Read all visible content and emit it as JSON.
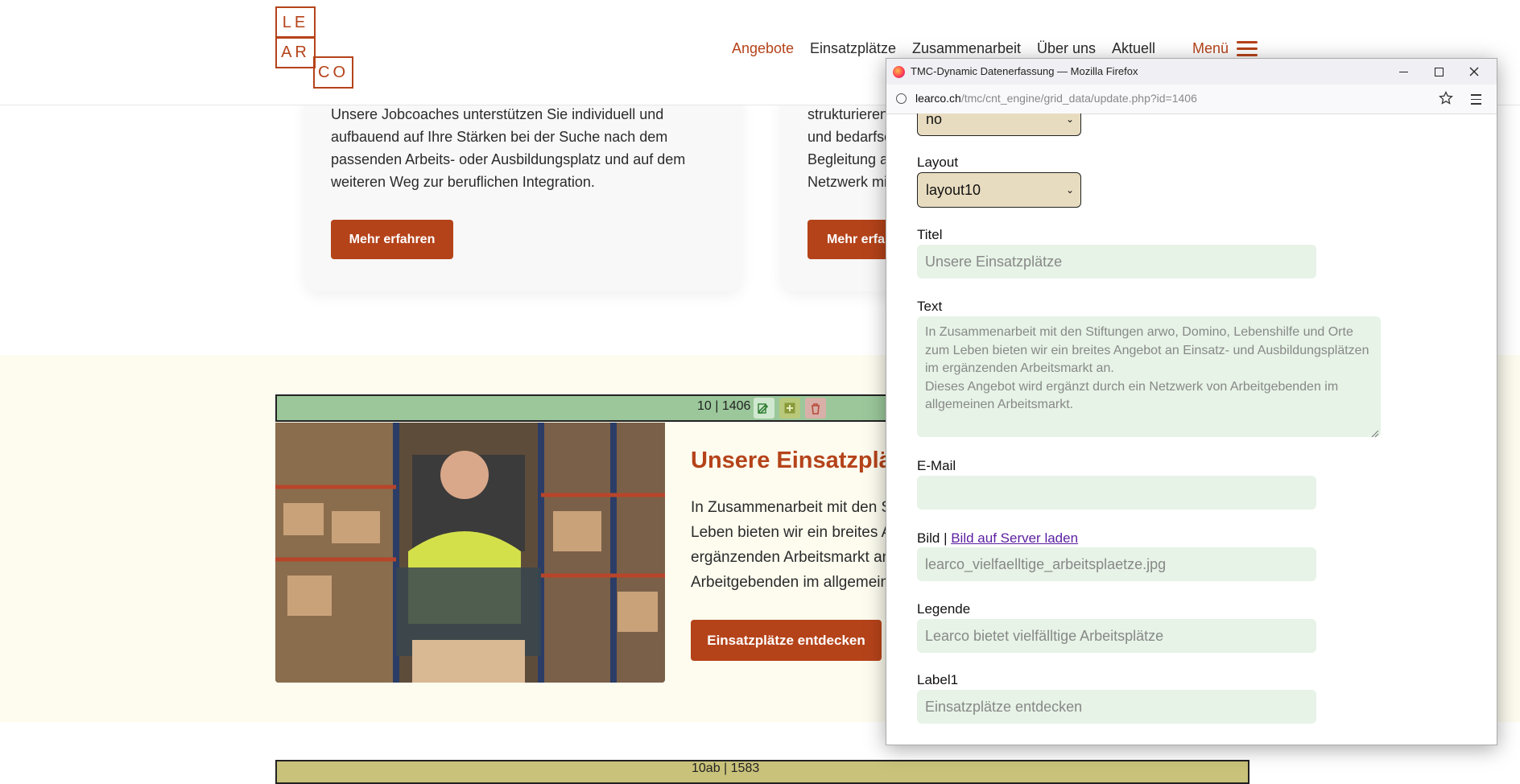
{
  "header": {
    "logo_letters": [
      "LE",
      "AR",
      "CO"
    ],
    "nav": [
      {
        "label": "Angebote",
        "active": true
      },
      {
        "label": "Einsatzplätze",
        "active": false
      },
      {
        "label": "Zusammenarbeit",
        "active": false
      },
      {
        "label": "Über uns",
        "active": false
      },
      {
        "label": "Aktuell",
        "active": false
      }
    ],
    "menu_label": "Menü"
  },
  "cards": [
    {
      "text_lines": [
        "Unsere Jobcoaches unterstützen Sie individuell und",
        "aufbauend auf Ihre Stärken bei der Suche nach dem",
        "passenden Arbeits- oder Ausbildungsplatz und auf dem",
        "weiteren Weg zur beruflichen Integration."
      ],
      "button": "Mehr erfahren"
    },
    {
      "text_lines": [
        "strukturieren",
        "und bedarfso",
        "Begleitung a",
        "Netzwerk mi"
      ],
      "button": "Mehr erfa"
    }
  ],
  "section": {
    "admin_id": "10 | 1406",
    "title": "Unsere Einsatzplät",
    "text_lines": [
      "In Zusammenarbeit mit den S",
      "Leben bieten wir ein breites A",
      "ergänzenden Arbeitsmarkt an",
      "Arbeitgebenden im allgemein"
    ],
    "button": "Einsatzplätze entdecken",
    "admin_id_2": "10ab | 1583"
  },
  "firefox": {
    "window_title": "TMC-Dynamic Datenerfassung — Mozilla Firefox",
    "url_domain": "learco.ch",
    "url_path": "/tmc/cnt_engine/grid_data/update.php?id=1406",
    "form": {
      "top_select_value": "no",
      "layout_label": "Layout",
      "layout_value": "layout10",
      "titel_label": "Titel",
      "titel_value": "Unsere Einsatzplätze",
      "text_label": "Text",
      "text_value": "In Zusammenarbeit mit den Stiftungen arwo, Domino, Lebenshilfe und Orte zum Leben bieten wir ein breites Angebot an Einsatz- und Ausbildungsplätzen im ergänzenden Arbeitsmarkt an.\nDieses Angebot wird ergänzt durch ein Netzwerk von Arbeitgebenden im allgemeinen Arbeitsmarkt.",
      "email_label": "E-Mail",
      "email_value": "",
      "bild_label": "Bild | ",
      "bild_link": "Bild auf Server laden",
      "bild_value": "learco_vielfaelltige_arbeitsplaetze.jpg",
      "legende_label": "Legende",
      "legende_value": "Learco bietet vielfälltige Arbeitsplätze",
      "label1_label": "Label1",
      "label1_value": "Einsatzplätze entdecken"
    }
  },
  "colors": {
    "brand": "#b5431a",
    "section_bg": "#fdfcef",
    "admin_bar": "#9bc79b",
    "input_bg": "#e6f3e6",
    "select_bg": "#e8dcc0"
  }
}
